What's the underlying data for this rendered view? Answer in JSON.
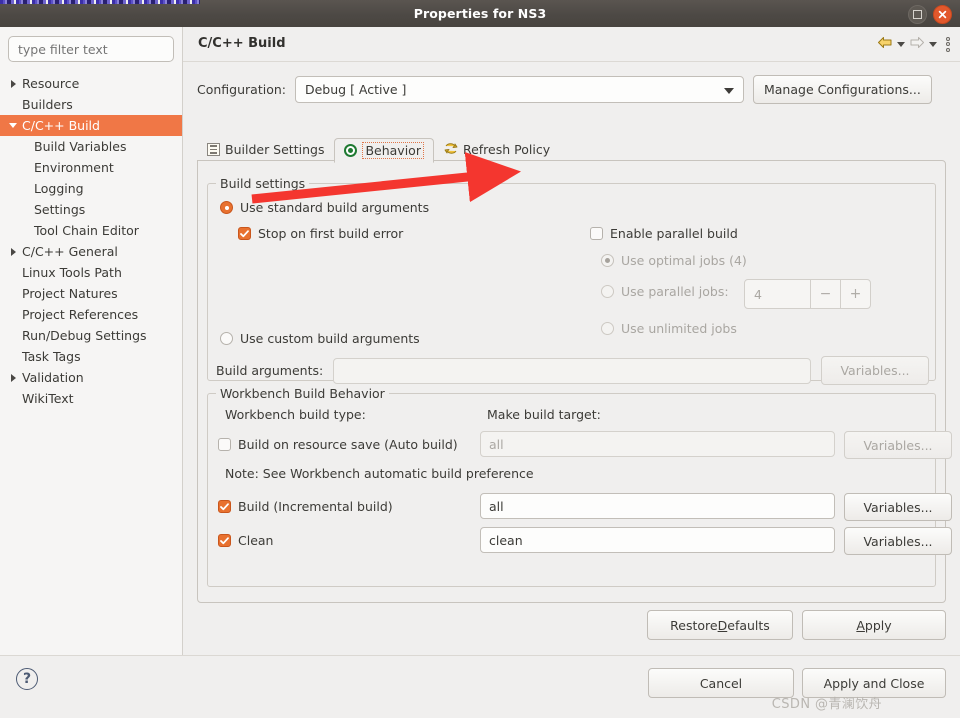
{
  "window": {
    "title": "Properties for NS3",
    "maximize_icon": "maximize-icon",
    "close_icon": "close-icon"
  },
  "sidebar": {
    "filter": {
      "placeholder": "type filter text",
      "value": ""
    },
    "items": [
      {
        "label": "Resource",
        "twisty": "right",
        "indent": 0,
        "selected": false
      },
      {
        "label": "Builders",
        "twisty": "none",
        "indent": 0,
        "selected": false
      },
      {
        "label": "C/C++ Build",
        "twisty": "down",
        "indent": 0,
        "selected": true
      },
      {
        "label": "Build Variables",
        "twisty": "none",
        "indent": 1,
        "selected": false
      },
      {
        "label": "Environment",
        "twisty": "none",
        "indent": 1,
        "selected": false
      },
      {
        "label": "Logging",
        "twisty": "none",
        "indent": 1,
        "selected": false
      },
      {
        "label": "Settings",
        "twisty": "none",
        "indent": 1,
        "selected": false
      },
      {
        "label": "Tool Chain Editor",
        "twisty": "none",
        "indent": 1,
        "selected": false
      },
      {
        "label": "C/C++ General",
        "twisty": "right",
        "indent": 0,
        "selected": false
      },
      {
        "label": "Linux Tools Path",
        "twisty": "none",
        "indent": 0,
        "selected": false
      },
      {
        "label": "Project Natures",
        "twisty": "none",
        "indent": 0,
        "selected": false
      },
      {
        "label": "Project References",
        "twisty": "none",
        "indent": 0,
        "selected": false
      },
      {
        "label": "Run/Debug Settings",
        "twisty": "none",
        "indent": 0,
        "selected": false
      },
      {
        "label": "Task Tags",
        "twisty": "none",
        "indent": 0,
        "selected": false
      },
      {
        "label": "Validation",
        "twisty": "right",
        "indent": 0,
        "selected": false
      },
      {
        "label": "WikiText",
        "twisty": "none",
        "indent": 0,
        "selected": false
      }
    ]
  },
  "pane": {
    "title": "C/C++ Build",
    "nav": {
      "back_icon": "back-arrow-icon",
      "back_menu_icon": "chevron-down-icon",
      "forward_icon": "forward-arrow-icon",
      "forward_menu_icon": "chevron-down-icon",
      "menu_icon": "view-menu-icon"
    },
    "configuration": {
      "label": "Configuration:",
      "value": "Debug [ Active ]",
      "manage_button": "Manage Configurations..."
    },
    "tabs": [
      {
        "label": "Builder Settings",
        "icon": "list-icon",
        "active": false
      },
      {
        "label": "Behavior",
        "icon": "green-radio-icon",
        "active": true
      },
      {
        "label": "Refresh Policy",
        "icon": "refresh-arrows-icon",
        "active": false
      }
    ],
    "build_settings": {
      "group_title": "Build settings",
      "use_standard": {
        "label": "Use standard build arguments",
        "checked": true
      },
      "stop_on_first_error": {
        "label": "Stop on first build error",
        "checked": true
      },
      "enable_parallel": {
        "label": "Enable parallel build",
        "checked": false
      },
      "use_optimal_jobs": {
        "label": "Use optimal jobs (4)",
        "checked": true,
        "disabled": true
      },
      "use_parallel_jobs": {
        "label": "Use parallel jobs:",
        "checked": false,
        "disabled": true
      },
      "jobs_value": "4",
      "spinner_down": "−",
      "spinner_up": "+",
      "use_unlimited_jobs": {
        "label": "Use unlimited jobs",
        "checked": false,
        "disabled": true
      },
      "use_custom": {
        "label": "Use custom build arguments",
        "checked": false
      },
      "build_arguments_label": "Build arguments:",
      "build_arguments_value": "",
      "build_arguments_variables_button": "Variables..."
    },
    "workbench_behavior": {
      "group_title": "Workbench Build Behavior",
      "build_type_label": "Workbench build type:",
      "make_target_label": "Make build target:",
      "rows": [
        {
          "label": "Build on resource save (Auto build)",
          "checked": false,
          "disabled": true,
          "target": "all",
          "button": "Variables..."
        },
        {
          "label": "Build (Incremental build)",
          "checked": true,
          "disabled": false,
          "target": "all",
          "button": "Variables..."
        },
        {
          "label": "Clean",
          "checked": true,
          "disabled": false,
          "target": "clean",
          "button": "Variables..."
        }
      ],
      "note": "Note: See Workbench automatic build preference"
    },
    "restore_defaults_button": {
      "prefix": "Restore ",
      "mnemonic": "D",
      "suffix": "efaults"
    },
    "apply_button": {
      "mnemonic": "A",
      "suffix": "pply"
    }
  },
  "footer": {
    "help_icon": "help-icon",
    "cancel_button": "Cancel",
    "apply_and_close_button": "Apply and Close",
    "watermark": "CSDN @青澜饮舟"
  },
  "annotation": {
    "arrow_color": "#f4362f",
    "arrow_target": "Refresh Policy"
  },
  "colors": {
    "accent_orange": "#f07746",
    "control_orange": "#e8712f",
    "titlebar": "#4d4945",
    "window_bg": "#f0efee"
  }
}
